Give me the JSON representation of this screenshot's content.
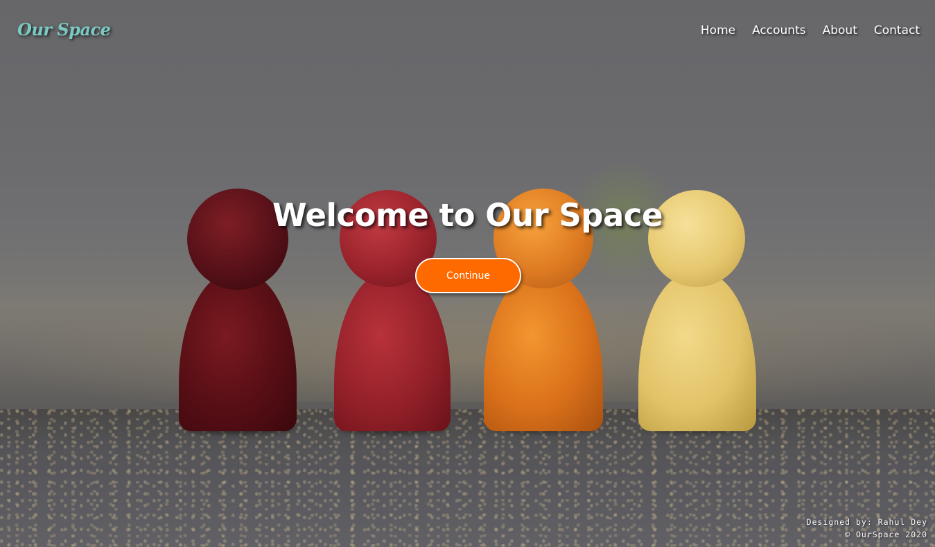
{
  "header": {
    "logo_text": "Our Space",
    "nav": [
      {
        "label": "Home"
      },
      {
        "label": "Accounts"
      },
      {
        "label": "About"
      },
      {
        "label": "Contact"
      }
    ]
  },
  "hero": {
    "title": "Welcome to Our Space",
    "button_label": "Continue"
  },
  "footer": {
    "designer": "Designed by: Rahul Dey",
    "copyright": "© OurSpace 2020"
  },
  "colors": {
    "logo": "#7cc9c4",
    "button": "#ff6a00",
    "text": "#ffffff"
  },
  "background": {
    "description_icon": "wooden-pawns-photo"
  }
}
